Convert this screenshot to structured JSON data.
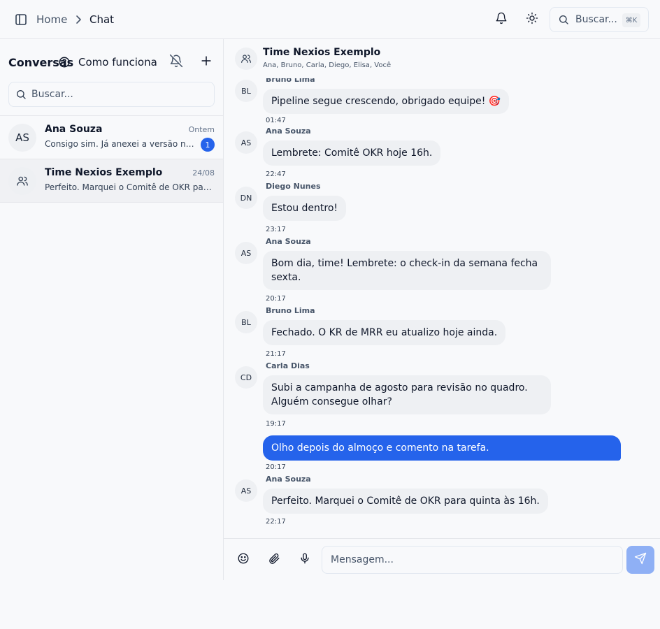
{
  "breadcrumb": {
    "home": "Home",
    "current": "Chat"
  },
  "top_search": {
    "label": "Buscar...",
    "shortcut": "⌘K"
  },
  "sidebar": {
    "title": "Conversas",
    "how_it_works": "Como funciona",
    "search_placeholder": "Buscar...",
    "conversations": [
      {
        "initials": "AS",
        "name": "Ana Souza",
        "time": "Ontem",
        "preview": "Consigo sim. Já anexei a versão nova no quadro.",
        "unread": "1"
      },
      {
        "name": "Time Nexios Exemplo",
        "time": "24/08",
        "preview": "Perfeito. Marquei o Comitê de OKR para quinta às 16h."
      }
    ]
  },
  "chat": {
    "group_name": "Time Nexios Exemplo",
    "members": "Ana, Bruno, Carla, Diego, Elisa, Você",
    "messages": [
      {
        "initials": "BL",
        "sender": "Bruno Lima",
        "text": "Pipeline segue crescendo, obrigado equipe! 🎯",
        "time": "01:47"
      },
      {
        "initials": "AS",
        "sender": "Ana Souza",
        "text": "Lembrete: Comitê OKR hoje 16h.",
        "time": "22:47"
      },
      {
        "initials": "DN",
        "sender": "Diego Nunes",
        "text": "Estou dentro!",
        "time": "23:17"
      },
      {
        "initials": "AS",
        "sender": "Ana Souza",
        "text": "Bom dia, time! Lembrete: o check-in da semana fecha sexta.",
        "time": "20:17"
      },
      {
        "initials": "BL",
        "sender": "Bruno Lima",
        "text": "Fechado. O KR de MRR eu atualizo hoje ainda.",
        "time": "21:17"
      },
      {
        "initials": "CD",
        "sender": "Carla Dias",
        "text": "Subi a campanha de agosto para revisão no quadro. Alguém consegue olhar?",
        "time": "19:17"
      },
      {
        "text": "Olho depois do almoço e comento na tarefa.",
        "time": "20:17",
        "mine": true
      },
      {
        "initials": "AS",
        "sender": "Ana Souza",
        "text": "Perfeito. Marquei o Comitê de OKR para quinta às 16h.",
        "time": "22:17"
      }
    ]
  },
  "composer": {
    "placeholder": "Mensagem..."
  },
  "colors": {
    "accent": "#2563eb",
    "send_disabled": "#8fb0f5",
    "bubble": "#eef0f3"
  },
  "icons": [
    "sidebar-toggle-icon",
    "chevron-right-icon",
    "bell-icon",
    "sun-icon",
    "search-icon",
    "help-icon",
    "bell-off-icon",
    "plus-icon",
    "users-icon",
    "smile-icon",
    "paperclip-icon",
    "mic-icon",
    "send-icon"
  ]
}
